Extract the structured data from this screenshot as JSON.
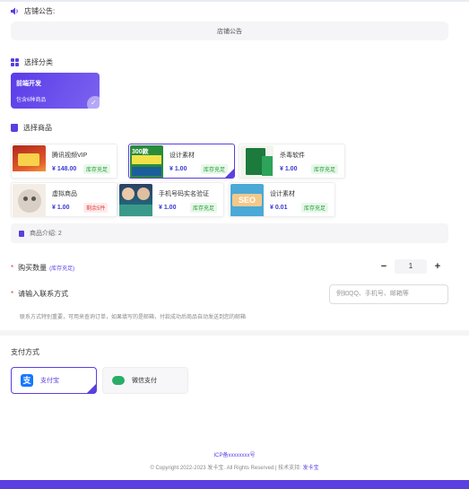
{
  "announcement": {
    "label": "店铺公告:",
    "content": "店铺公告"
  },
  "category_section": {
    "title": "选择分类"
  },
  "categories": [
    {
      "name": "前端开发",
      "desc": "包含6种商品",
      "selected": true
    }
  ],
  "product_section": {
    "title": "选择商品"
  },
  "products": [
    {
      "name": "腾讯视频VIP",
      "price": "¥ 148.00",
      "stock": "库存充足",
      "stock_type": "ok",
      "image": "tencent-video-thumbnail",
      "selected": false
    },
    {
      "name": "设计素材",
      "price": "¥ 1.00",
      "stock": "库存充足",
      "stock_type": "ok",
      "image": "poster-font-thumbnail",
      "image_text": "300款",
      "selected": true
    },
    {
      "name": "杀毒软件",
      "price": "¥ 1.00",
      "stock": "库存充足",
      "stock_type": "ok",
      "image": "antivirus-box-thumbnail",
      "selected": false
    },
    {
      "name": "虚拟商品",
      "price": "¥ 1.00",
      "stock": "剩余5件",
      "stock_type": "low",
      "image": "cat-thumbnail",
      "selected": false
    },
    {
      "name": "手机号码实名验证",
      "price": "¥ 1.00",
      "stock": "库存充足",
      "stock_type": "ok",
      "image": "course-thumbnail",
      "selected": false
    },
    {
      "name": "设计素材",
      "price": "¥ 0.01",
      "stock": "库存充足",
      "stock_type": "ok",
      "image": "seo-thumbnail",
      "image_text": "SEO",
      "selected": false
    }
  ],
  "product_desc": "商品介绍: 2",
  "quantity": {
    "label": "购买数量",
    "sub": "(库存充足)",
    "minus": "−",
    "value": "1",
    "plus": "+"
  },
  "contact": {
    "label": "请输入联系方式",
    "placeholder": "例如QQ、手机号、邮箱等",
    "hint": "联系方式特别重要，可用来查询订单，如果填写的是邮箱，付款成功后商品自动发送到您的邮箱"
  },
  "payment": {
    "label": "支付方式",
    "options": [
      {
        "name": "支付宝",
        "selected": true
      },
      {
        "name": "微信支付",
        "selected": false
      }
    ]
  },
  "footer": {
    "icp": "ICP备xxxxxxxx号",
    "copyright": "© Copyright 2022-2023 发卡宝. All Rights Reserved | 技术支持:",
    "tech": "发卡宝"
  },
  "colors": {
    "accent": "#5b3fe0",
    "stock_ok": "#1a9b2e",
    "stock_low": "#e24040"
  }
}
